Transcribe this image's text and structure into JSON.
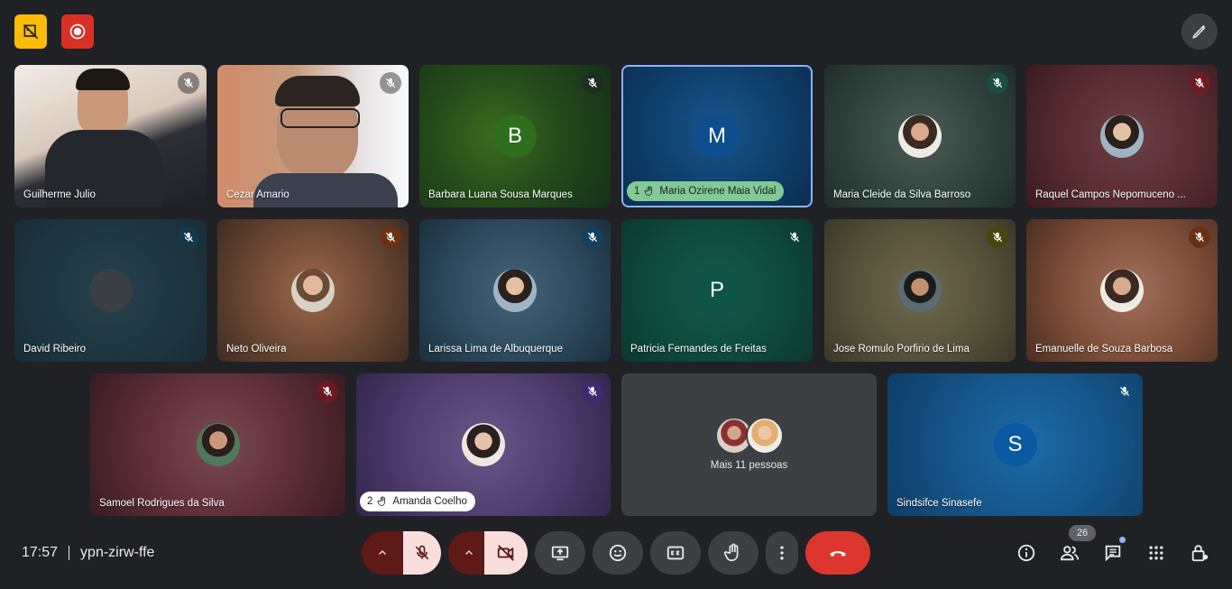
{
  "colors": {
    "background": "#202124",
    "accent_blue": "#8ab4f8",
    "end_call_red": "#dc362e",
    "muted_pill": "#5e1a16",
    "hand_badge_green": "#81c995"
  },
  "top": {
    "left_icons": [
      "visual-effects-off-icon",
      "recording-icon"
    ],
    "right_icon": "edit-pen-icon"
  },
  "tiles": [
    {
      "name": "Guilherme Julio",
      "type": "video",
      "muted": true
    },
    {
      "name": "Cezar Amario",
      "type": "video",
      "muted": true
    },
    {
      "name": "Barbara Luana Sousa Marques",
      "type": "letter",
      "letter": "B",
      "muted": true
    },
    {
      "name": "Maria Ozirene Maia Vidal",
      "type": "letter",
      "letter": "M",
      "muted": false,
      "hand_raised": true,
      "hand_order": "1",
      "active_speaker": true
    },
    {
      "name": "Maria Cleide da Silva Barroso",
      "type": "photo",
      "muted": true
    },
    {
      "name": "Raquel Campos Nepomuceno ...",
      "type": "photo",
      "muted": true
    },
    {
      "name": "David Ribeiro",
      "type": "blank",
      "muted": true
    },
    {
      "name": "Neto Oliveira",
      "type": "photo",
      "muted": true
    },
    {
      "name": "Larissa Lima de Albuquerque",
      "type": "photo",
      "muted": true
    },
    {
      "name": "Patricia Fernandes de Freitas",
      "type": "letter",
      "letter": "P",
      "muted": true
    },
    {
      "name": "Jose Romulo Porfirio de Lima",
      "type": "photo",
      "muted": true
    },
    {
      "name": "Emanuelle de Souza Barbosa",
      "type": "photo",
      "muted": true
    },
    {
      "name": "Samoel Rodrigues da Silva",
      "type": "photo",
      "muted": true
    },
    {
      "name": "Amanda Coelho",
      "type": "photo",
      "muted": true,
      "hand_raised": true,
      "hand_order": "2"
    },
    {
      "name": "Mais 11 pessoas",
      "type": "more"
    },
    {
      "name": "Sindsifce Sinasefe",
      "type": "letter",
      "letter": "S",
      "muted": true
    }
  ],
  "bottom": {
    "time": "17:57",
    "meeting_code": "ypn-zirw-ffe",
    "participants_count": "26",
    "controls": [
      "mic-options",
      "mic-off",
      "camera-options",
      "camera-off",
      "present-screen",
      "emoji-reactions",
      "captions",
      "raise-hand",
      "more-options",
      "leave-call"
    ],
    "right_controls": [
      "meeting-info",
      "people",
      "chat",
      "activities",
      "host-controls"
    ]
  }
}
